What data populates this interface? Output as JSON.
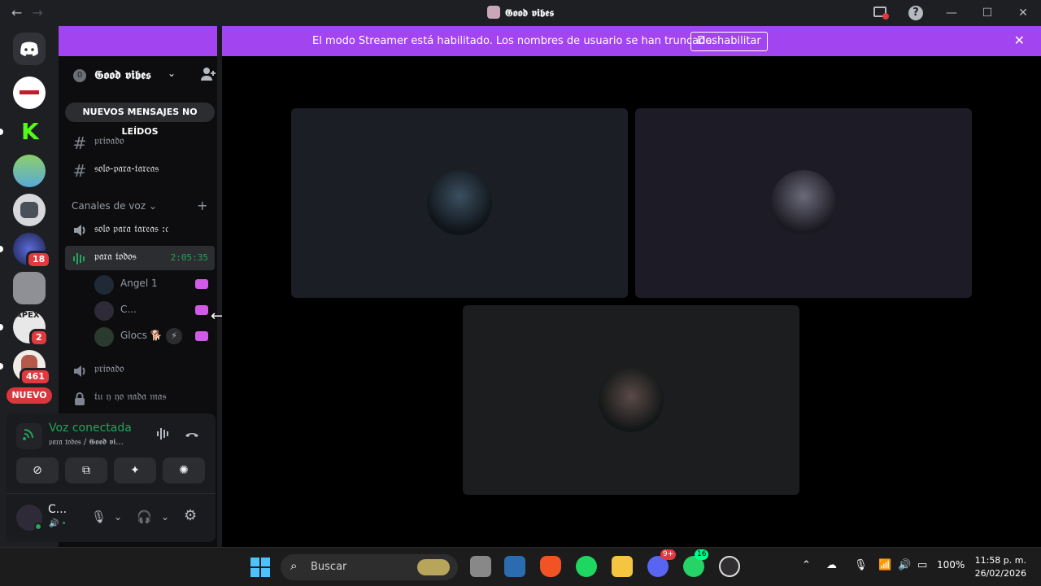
{
  "window": {
    "title": "𝕲𝖔𝖔𝖉 𝖛𝖎𝖇𝖊𝖘",
    "back": "←",
    "forward": "→",
    "help": "?",
    "minimize": "—",
    "maximize": "☐",
    "close": "✕"
  },
  "servers": {
    "new_label": "NUEVO",
    "badges": [
      "18",
      "2",
      "461"
    ]
  },
  "banner": {
    "text": "El modo Streamer está habilitado. Los nombres de usuario se han truncado.",
    "button": "Deshabilitar",
    "close": "✕"
  },
  "guild": {
    "icon_text": "0",
    "name": "𝕲𝖔𝖔𝖉 𝖛𝖎𝖇𝖊𝖘",
    "chevron": "⌄",
    "invite_icon": "👤+"
  },
  "sidebar": {
    "unread_label": "NUEVOS MENSAJES NO LEÍDOS",
    "text_channels": [
      {
        "icon": "#",
        "name": "𝔭𝔯𝔦𝔳𝔞𝔡𝔬"
      },
      {
        "icon": "#",
        "name": "𝔰𝔬𝔩𝔬-𝔭𝔞𝔯𝔞-𝔱𝔞𝔯𝔢𝔞𝔰"
      }
    ],
    "voice_category": "Canales de voz",
    "voice_category_chevron": "⌄",
    "voice_add": "+",
    "voice_channels": [
      {
        "icon": "🔊",
        "name": "𝔰𝔬𝔩𝔬 𝔭𝔞𝔯𝔞 𝔱𝔞𝔯𝔢𝔞𝔰 :𝔠"
      },
      {
        "icon": "|||",
        "name": "𝔭𝔞𝔯𝔞 𝔱𝔬𝔡𝔬𝔰",
        "timer": "2:05:35"
      },
      {
        "icon": "🔊",
        "name": "𝔭𝔯𝔦𝔳𝔞𝔡𝔬"
      },
      {
        "icon": "🔒",
        "name": "𝔱𝔲 𝔶 𝔶𝔬 𝔫𝔞𝔡𝔞 𝔪𝔞𝔰"
      }
    ],
    "voice_users": [
      {
        "name": "Angel 1"
      },
      {
        "name": "C..."
      },
      {
        "name": "Glocs 🐕",
        "extra": "⚡"
      }
    ]
  },
  "voice_panel": {
    "status": "Voz conectada",
    "sub": "𝔭𝔞𝔯𝔞 𝔱𝔬𝔡𝔬𝔰 / 𝕲𝖔𝖔𝖉 𝖛𝖎...",
    "noise_icon": "|||",
    "disconnect_icon": "☎",
    "buttons": [
      "⊘",
      "⧉",
      "✦",
      "✺"
    ]
  },
  "user": {
    "name": "C...",
    "sub": "🔊 •",
    "mic": "🎙",
    "headset": "🎧",
    "settings": "⚙",
    "chevron": "⌄"
  },
  "taskbar": {
    "search_placeholder": "Buscar",
    "discord_badge": "9+",
    "whatsapp_badge": "16",
    "battery": "100%",
    "time": "11:58 p. m.",
    "date": "26/02/2026"
  },
  "colors": {
    "banner": "#a244f0",
    "voice_green": "#23a55a",
    "badge_red": "#e03a3e"
  }
}
